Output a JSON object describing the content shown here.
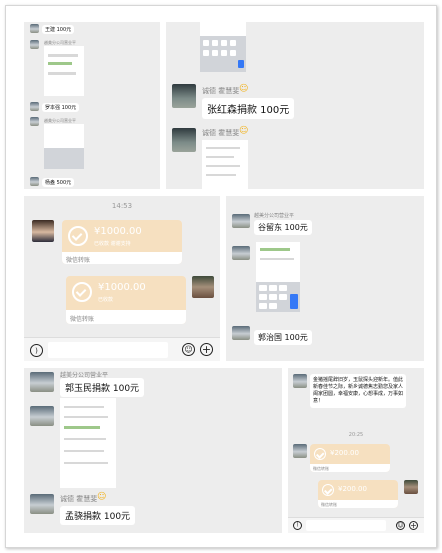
{
  "top_left": {
    "rows": [
      {
        "name_label": "王建 100元"
      },
      {
        "header": "越美分公司营业平"
      },
      {
        "name_label": "罗本强 100元"
      },
      {
        "header": "越美分公司营业平"
      },
      {
        "name_label": "杨盎 500元"
      }
    ]
  },
  "top_right": {
    "sender": "诚德 霍慧斐",
    "message1": "张红森捐款 100元"
  },
  "mid_left": {
    "time": "14:53",
    "transfer1": {
      "amount": "¥1000.00",
      "note": "已收款  谢谢支持",
      "footer": "微信转账"
    },
    "transfer2": {
      "amount": "¥1000.00",
      "note": "已收款",
      "footer": "微信转账"
    }
  },
  "mid_right": {
    "group": "越美分公司营业平",
    "message1": "谷留东 100元",
    "message2": "郭治国 100元"
  },
  "bottom_left": {
    "group": "越美分公司营业平",
    "message1": "郭玉民捐款 100元",
    "sender": "诚德 霍慧斐",
    "message2": "孟骁捐款 100元"
  },
  "bottom_right": {
    "greeting": "金猪摇尾辞旧岁，玉鼠探头迎新年。值此新春佳节之际，新乡诚德焦志勤您及家人阖家团圆，幸福安康，心想事成，万事如意！",
    "time": "20:25",
    "transfer1": {
      "amount": "¥200.00",
      "footer": "微信转账"
    },
    "transfer2": {
      "amount": "¥200.00",
      "footer": "微信转账"
    }
  },
  "colors": {
    "background": "#ededed",
    "transfer": "#f6e0c0",
    "bubble": "#ffffff"
  },
  "icons": [
    "voice-icon",
    "emoji-icon",
    "plus-icon",
    "smile-emoji-icon"
  ]
}
